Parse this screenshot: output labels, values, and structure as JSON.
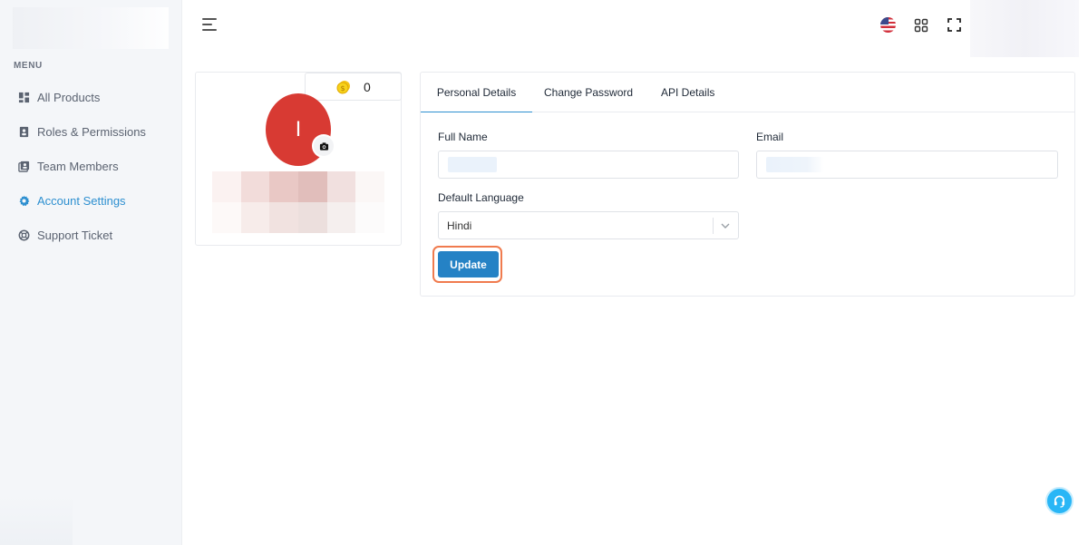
{
  "sidebar": {
    "menu_heading": "MENU",
    "items": [
      {
        "label": "All Products",
        "icon": "grid-icon",
        "active": false
      },
      {
        "label": "Roles & Permissions",
        "icon": "id-badge-icon",
        "active": false
      },
      {
        "label": "Team Members",
        "icon": "contacts-icon",
        "active": false
      },
      {
        "label": "Account Settings",
        "icon": "gear-icon",
        "active": true
      },
      {
        "label": "Support Ticket",
        "icon": "lifebuoy-icon",
        "active": false
      }
    ]
  },
  "topbar": {
    "language_flag": "us-flag-icon"
  },
  "profile": {
    "coins": "0",
    "avatar_initial": "I"
  },
  "settings": {
    "tabs": [
      "Personal Details",
      "Change Password",
      "API Details"
    ],
    "active_tab": "Personal Details",
    "full_name_label": "Full Name",
    "email_label": "Email",
    "default_language_label": "Default Language",
    "default_language_value": "Hindi",
    "update_label": "Update"
  },
  "colors": {
    "accent": "#2d8fd0",
    "button": "#2582c5",
    "avatar": "#d83a33",
    "highlight_outline": "#f07b4e",
    "help_button": "#29b6f6"
  }
}
